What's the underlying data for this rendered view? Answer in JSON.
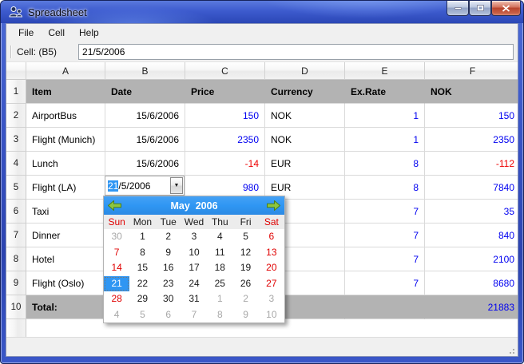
{
  "window": {
    "title": "Spreadsheet"
  },
  "menu": {
    "items": [
      "File",
      "Cell",
      "Help"
    ]
  },
  "toolbar": {
    "cell_label": "Cell: (B5)",
    "cell_value": "21/5/2006"
  },
  "grid": {
    "column_letters": [
      "A",
      "B",
      "C",
      "D",
      "E",
      "F"
    ],
    "rows": [
      {
        "num": "1",
        "gray": true,
        "bold": true,
        "cells": [
          {
            "t": "Item"
          },
          {
            "t": "Date"
          },
          {
            "t": "Price"
          },
          {
            "t": "Currency"
          },
          {
            "t": "Ex.Rate"
          },
          {
            "t": "NOK"
          }
        ]
      },
      {
        "num": "2",
        "cells": [
          {
            "t": "AirportBus"
          },
          {
            "t": "15/6/2006",
            "a": "r"
          },
          {
            "t": "150",
            "a": "r",
            "c": "blue"
          },
          {
            "t": "NOK"
          },
          {
            "t": "1",
            "a": "r",
            "c": "blue"
          },
          {
            "t": "150",
            "a": "r",
            "c": "blue"
          }
        ]
      },
      {
        "num": "3",
        "cells": [
          {
            "t": "Flight (Munich)"
          },
          {
            "t": "15/6/2006",
            "a": "r"
          },
          {
            "t": "2350",
            "a": "r",
            "c": "blue"
          },
          {
            "t": "NOK"
          },
          {
            "t": "1",
            "a": "r",
            "c": "blue"
          },
          {
            "t": "2350",
            "a": "r",
            "c": "blue"
          }
        ]
      },
      {
        "num": "4",
        "cells": [
          {
            "t": "Lunch"
          },
          {
            "t": "15/6/2006",
            "a": "r"
          },
          {
            "t": "-14",
            "a": "r",
            "c": "red"
          },
          {
            "t": "EUR"
          },
          {
            "t": "8",
            "a": "r",
            "c": "blue"
          },
          {
            "t": "-112",
            "a": "r",
            "c": "red"
          }
        ]
      },
      {
        "num": "5",
        "cells": [
          {
            "t": "Flight (LA)"
          },
          {
            "t": ""
          },
          {
            "t": "980",
            "a": "r",
            "c": "blue"
          },
          {
            "t": "EUR"
          },
          {
            "t": "8",
            "a": "r",
            "c": "blue"
          },
          {
            "t": "7840",
            "a": "r",
            "c": "blue"
          }
        ]
      },
      {
        "num": "6",
        "cells": [
          {
            "t": "Taxi"
          },
          {},
          {},
          {},
          {
            "t": "7",
            "a": "r",
            "c": "blue"
          },
          {
            "t": "35",
            "a": "r",
            "c": "blue"
          }
        ]
      },
      {
        "num": "7",
        "cells": [
          {
            "t": "Dinner"
          },
          {},
          {},
          {},
          {
            "t": "7",
            "a": "r",
            "c": "blue"
          },
          {
            "t": "840",
            "a": "r",
            "c": "blue"
          }
        ]
      },
      {
        "num": "8",
        "cells": [
          {
            "t": "Hotel"
          },
          {},
          {},
          {},
          {
            "t": "7",
            "a": "r",
            "c": "blue"
          },
          {
            "t": "2100",
            "a": "r",
            "c": "blue"
          }
        ]
      },
      {
        "num": "9",
        "cells": [
          {
            "t": "Flight (Oslo)"
          },
          {},
          {},
          {},
          {
            "t": "7",
            "a": "r",
            "c": "blue"
          },
          {
            "t": "8680",
            "a": "r",
            "c": "blue"
          }
        ]
      },
      {
        "num": "10",
        "gray": true,
        "cells": [
          {
            "t": "Total:",
            "bold": true
          },
          {},
          {},
          {},
          {},
          {
            "t": "21883",
            "a": "r",
            "c": "blue"
          }
        ]
      }
    ]
  },
  "editor": {
    "selected": "21",
    "rest": "/5/2006"
  },
  "calendar": {
    "title": "May  2006",
    "day_names": [
      {
        "label": "Sun",
        "c": "red"
      },
      {
        "label": "Mon"
      },
      {
        "label": "Tue"
      },
      {
        "label": "Wed"
      },
      {
        "label": "Thu"
      },
      {
        "label": "Fri"
      },
      {
        "label": "Sat",
        "c": "red"
      }
    ],
    "weeks": [
      [
        {
          "d": "30",
          "c": "muted"
        },
        {
          "d": "1"
        },
        {
          "d": "2"
        },
        {
          "d": "3"
        },
        {
          "d": "4"
        },
        {
          "d": "5"
        },
        {
          "d": "6",
          "c": "red"
        }
      ],
      [
        {
          "d": "7",
          "c": "red"
        },
        {
          "d": "8"
        },
        {
          "d": "9"
        },
        {
          "d": "10"
        },
        {
          "d": "11"
        },
        {
          "d": "12"
        },
        {
          "d": "13",
          "c": "red"
        }
      ],
      [
        {
          "d": "14",
          "c": "red"
        },
        {
          "d": "15"
        },
        {
          "d": "16"
        },
        {
          "d": "17"
        },
        {
          "d": "18"
        },
        {
          "d": "19"
        },
        {
          "d": "20",
          "c": "red"
        }
      ],
      [
        {
          "d": "21",
          "c": "selected"
        },
        {
          "d": "22"
        },
        {
          "d": "23"
        },
        {
          "d": "24"
        },
        {
          "d": "25"
        },
        {
          "d": "26"
        },
        {
          "d": "27",
          "c": "red"
        }
      ],
      [
        {
          "d": "28",
          "c": "red"
        },
        {
          "d": "29"
        },
        {
          "d": "30"
        },
        {
          "d": "31"
        },
        {
          "d": "1",
          "c": "muted"
        },
        {
          "d": "2",
          "c": "muted"
        },
        {
          "d": "3",
          "c": "muted"
        }
      ],
      [
        {
          "d": "4",
          "c": "muted"
        },
        {
          "d": "5",
          "c": "muted"
        },
        {
          "d": "6",
          "c": "muted"
        },
        {
          "d": "7",
          "c": "muted"
        },
        {
          "d": "8",
          "c": "muted"
        },
        {
          "d": "9",
          "c": "muted"
        },
        {
          "d": "10",
          "c": "muted"
        }
      ]
    ]
  },
  "colors": {
    "titlebar_blue": "#3a57c8",
    "accent_blue": "#2f96f3",
    "value_blue": "#0000f0",
    "negative_red": "#ee0000",
    "weekend_red": "#e00000",
    "muted_gray": "#a8a8a8",
    "band_gray": "#b3b3b3",
    "arrow_green": "#8dc63f"
  }
}
